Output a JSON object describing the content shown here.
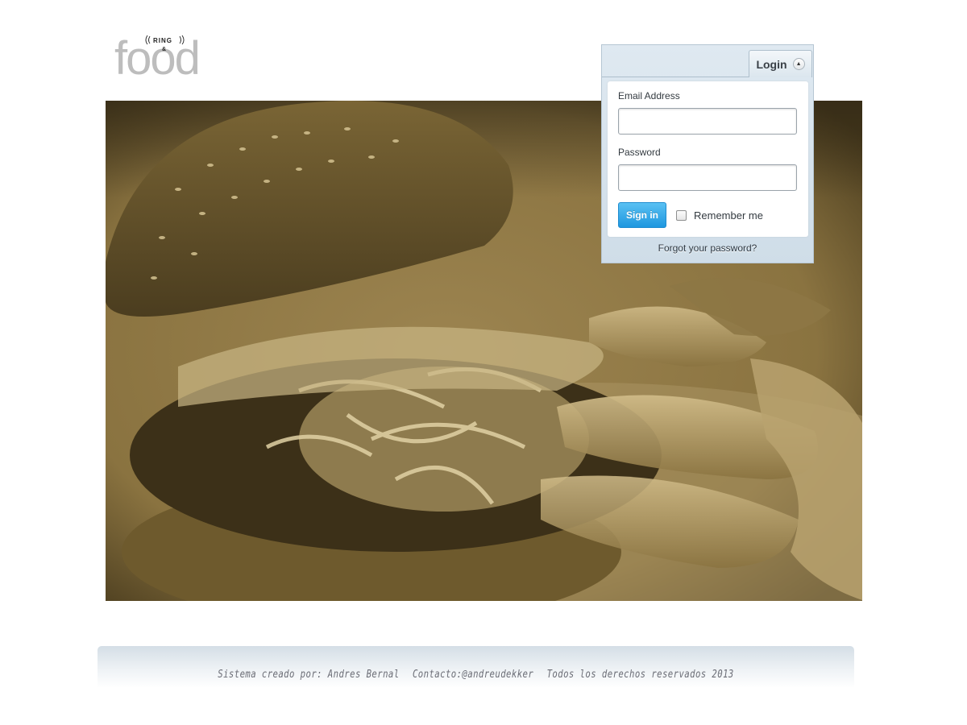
{
  "logo": {
    "wordmark": "food",
    "badge_top": "RING",
    "badge_amp": "&"
  },
  "hero": {
    "image": "burger-and-potato-wedges-photo",
    "tone": "#8a7340"
  },
  "login": {
    "tab_label": "Login",
    "tab_icon": "chevron-up-icon",
    "email_label": "Email Address",
    "email_value": "",
    "password_label": "Password",
    "password_value": "",
    "signin_label": "Sign in",
    "remember_label": "Remember me",
    "remember_checked": false,
    "forgot_label": "Forgot your password?"
  },
  "footer": {
    "created_by": "Sistema creado por: Andres Bernal",
    "contact": "Contacto:@andreudekker",
    "rights": "Todos los derechos reservados 2013"
  },
  "colors": {
    "accent": "#1e97df",
    "panel": "#d5e2ec",
    "sepia": "#8a7340"
  }
}
